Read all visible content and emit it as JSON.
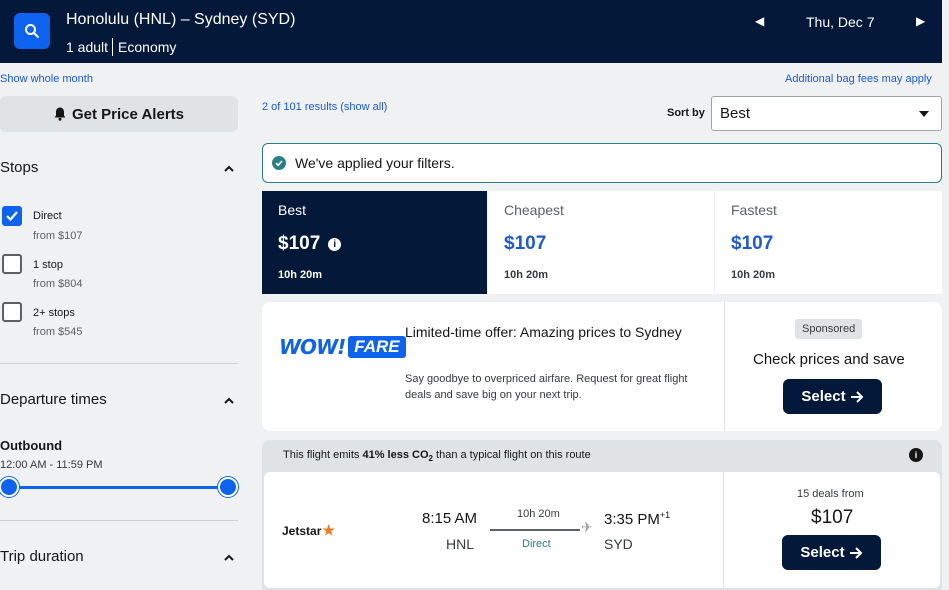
{
  "header": {
    "route": "Honolulu (HNL) – Sydney (SYD)",
    "travelers": "1 adult",
    "cabin": "Economy",
    "date": "Thu, Dec 7",
    "prev_icon": "◀",
    "next_icon": "▶"
  },
  "links": {
    "show_whole_month": "Show whole month",
    "bag_fees": "Additional bag fees may apply"
  },
  "sidebar": {
    "price_alerts_label": "Get Price Alerts",
    "stops_title": "Stops",
    "stops": [
      {
        "label": "Direct",
        "price": "from $107",
        "checked": true
      },
      {
        "label": "1 stop",
        "price": "from $804",
        "checked": false
      },
      {
        "label": "2+ stops",
        "price": "from $545",
        "checked": false
      }
    ],
    "departure_title": "Departure times",
    "outbound_label": "Outbound",
    "outbound_range": "12:00 AM - 11:59 PM",
    "trip_duration_title": "Trip duration"
  },
  "results": {
    "count_text": "2 of 101 results (show all)",
    "sort_label": "Sort by",
    "sort_value": "Best",
    "filter_note": "We've applied your filters."
  },
  "tabs": [
    {
      "name": "Best",
      "price": "$107",
      "duration": "10h 20m",
      "active": true
    },
    {
      "name": "Cheapest",
      "price": "$107",
      "duration": "10h 20m",
      "active": false
    },
    {
      "name": "Fastest",
      "price": "$107",
      "duration": "10h 20m",
      "active": false
    }
  ],
  "ad": {
    "logo_wow": "WOW!",
    "logo_fare": "FARE",
    "title": "Limited-time offer: Amazing prices to Sydney",
    "description": "Say goodbye to overpriced airfare. Request for great flight deals and save big on your next trip.",
    "sponsored": "Sponsored",
    "cta": "Check prices and save",
    "button": "Select"
  },
  "flight": {
    "co2_prefix": "This flight emits ",
    "co2_pct": "41% less CO",
    "co2_sub": "2",
    "co2_suffix": " than a typical flight on this route",
    "airline": "Jetstar",
    "dep_time": "8:15 AM",
    "dep_code": "HNL",
    "duration": "10h 20m",
    "stops": "Direct",
    "arr_time": "3:35 PM",
    "arr_offset": "+1",
    "arr_code": "SYD",
    "deals": "15 deals from",
    "price": "$107",
    "button": "Select"
  },
  "colors": {
    "navy": "#04183a",
    "accent_blue": "#0d62f0",
    "teal": "#2a7f86",
    "airline_orange": "#f47b20"
  }
}
